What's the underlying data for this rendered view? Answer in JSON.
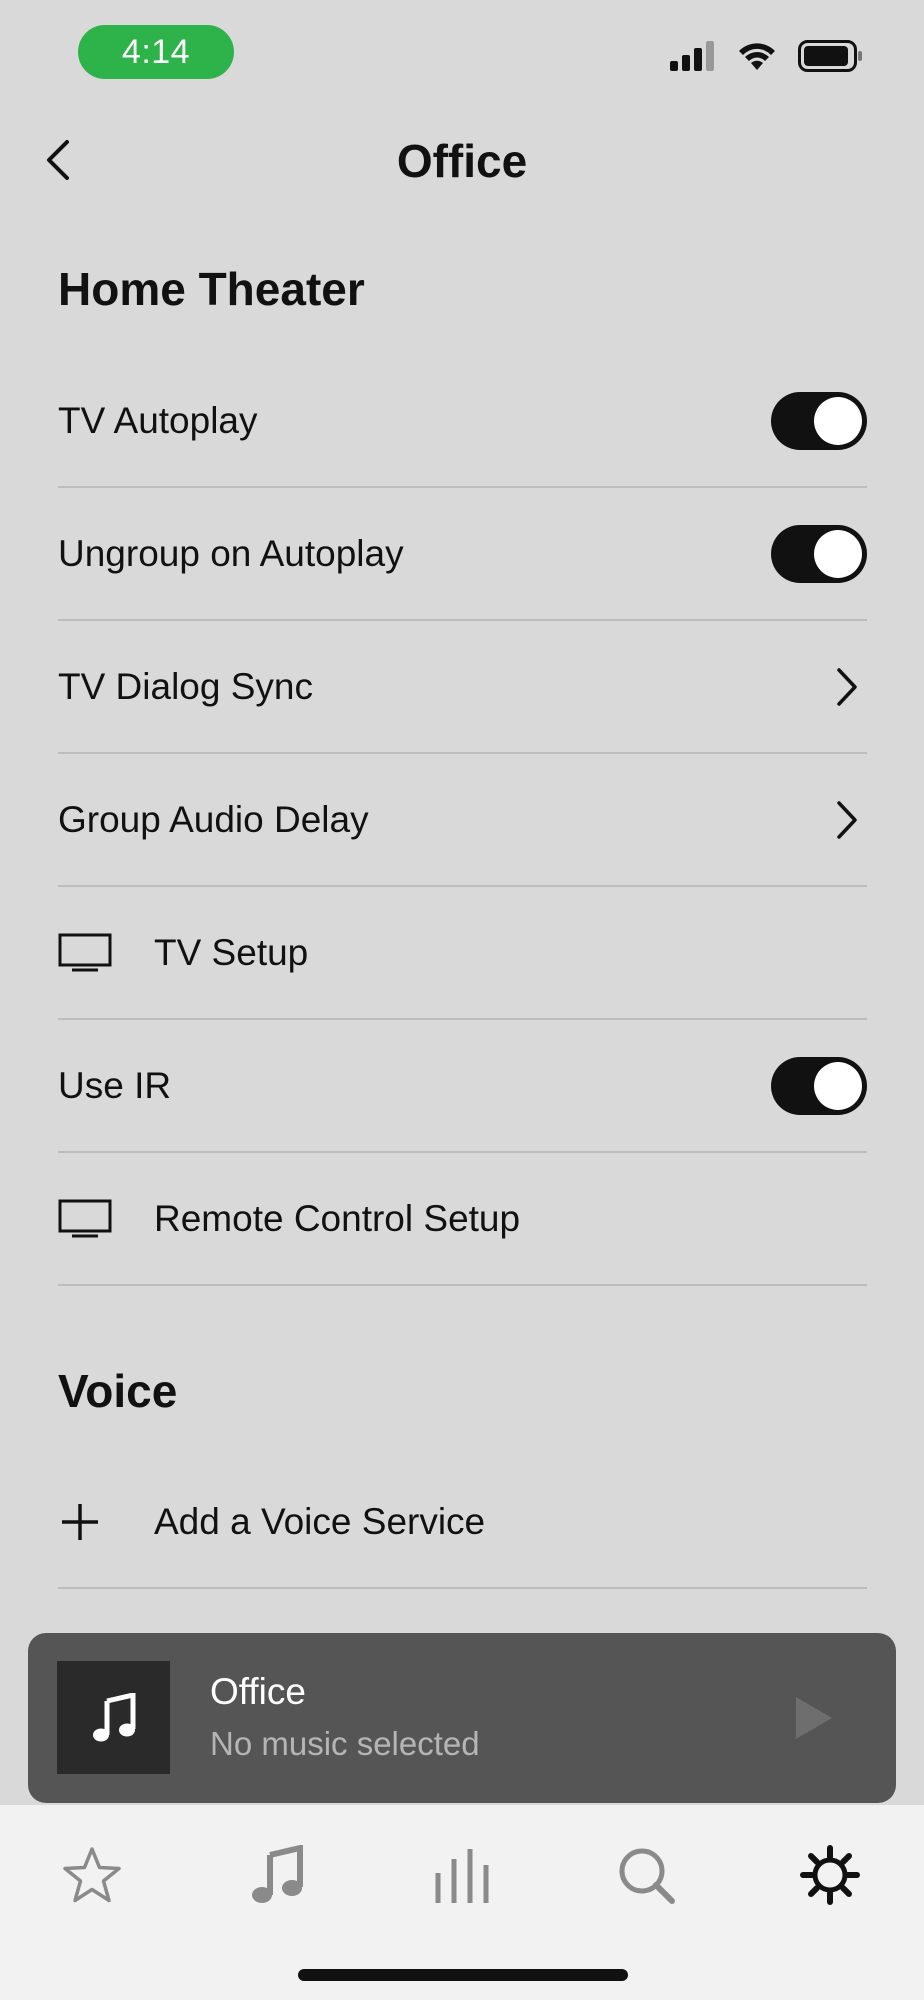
{
  "status": {
    "time": "4:14"
  },
  "header": {
    "title": "Office"
  },
  "home_theater": {
    "title": "Home Theater",
    "items": [
      {
        "label": "TV Autoplay",
        "control": "toggle",
        "on": true
      },
      {
        "label": "Ungroup on Autoplay",
        "control": "toggle",
        "on": true
      },
      {
        "label": "TV Dialog Sync",
        "control": "chevron"
      },
      {
        "label": "Group Audio Delay",
        "control": "chevron"
      },
      {
        "label": "TV Setup",
        "control": "none",
        "icon": "tv-icon"
      },
      {
        "label": "Use IR",
        "control": "toggle",
        "on": true
      },
      {
        "label": "Remote Control Setup",
        "control": "none",
        "icon": "tv-icon"
      }
    ]
  },
  "voice": {
    "title": "Voice",
    "items": [
      {
        "label": "Add a Voice Service",
        "icon": "plus-icon"
      }
    ]
  },
  "now_playing": {
    "title": "Office",
    "subtitle": "No music selected"
  },
  "tabs": [
    {
      "icon": "star-icon",
      "active": false
    },
    {
      "icon": "music-note-icon",
      "active": false
    },
    {
      "icon": "rooms-bars-icon",
      "active": false
    },
    {
      "icon": "search-icon",
      "active": false
    },
    {
      "icon": "gear-icon",
      "active": true
    }
  ],
  "colors": {
    "background": "#d9d9d9",
    "time_pill": "#2eb34a",
    "toggle_on": "#111111",
    "now_playing_bg": "#555555",
    "tab_bar_bg": "#f2f2f2"
  }
}
